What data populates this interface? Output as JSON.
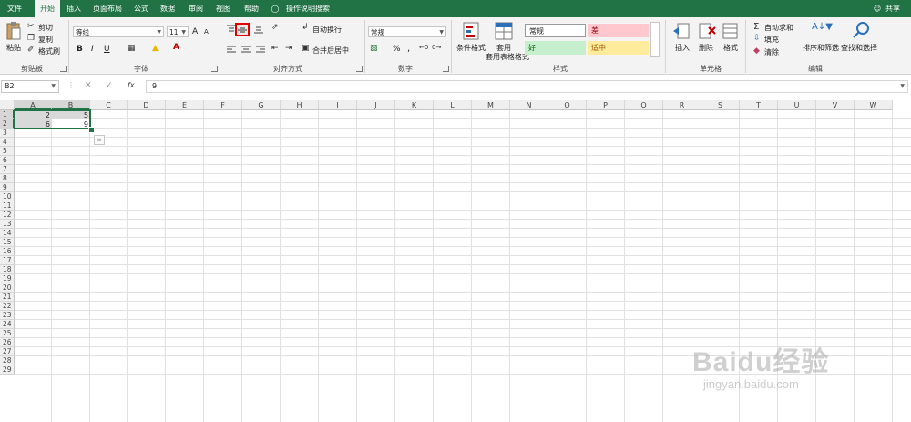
{
  "tabs": [
    "文件",
    "开始",
    "插入",
    "页面布局",
    "公式",
    "数据",
    "审阅",
    "视图",
    "帮助"
  ],
  "active_tab": "开始",
  "tell_me": "操作说明搜索",
  "share": "共享",
  "clipboard": {
    "paste": "粘贴",
    "cut": "剪切",
    "copy": "复制",
    "format_painter": "格式刷",
    "group": "剪贴板"
  },
  "font": {
    "name": "等线",
    "size": "11",
    "group": "字体",
    "bold": "B",
    "italic": "I",
    "underline": "U",
    "grow": "A",
    "shrink": "A"
  },
  "alignment": {
    "wrap": "自动换行",
    "merge": "合并后居中",
    "group": "对齐方式"
  },
  "number": {
    "format": "常规",
    "percent": "%",
    "comma": ",",
    "group": "数字"
  },
  "styles": {
    "conditional": "条件格式",
    "table_format": "套用表格格式",
    "normal": "常规",
    "bad": "差",
    "good": "好",
    "neutral": "适中",
    "group": "样式"
  },
  "cells": {
    "insert": "插入",
    "delete": "删除",
    "format": "格式",
    "group": "单元格"
  },
  "editing": {
    "autosum": "自动求和",
    "fill": "填充",
    "clear": "清除",
    "sort_filter": "排序和筛选",
    "find_select": "查找和选择",
    "group": "编辑"
  },
  "formula_bar": {
    "name_box": "B2",
    "fx": "fx",
    "value": "9"
  },
  "columns": [
    "A",
    "B",
    "C",
    "D",
    "E",
    "F",
    "G",
    "H",
    "I",
    "J",
    "K",
    "L",
    "M",
    "N",
    "O",
    "P",
    "Q",
    "R",
    "S",
    "T",
    "U",
    "V",
    "W"
  ],
  "rows": [
    "1",
    "2",
    "3",
    "4",
    "5",
    "6",
    "7",
    "8",
    "9",
    "10",
    "11",
    "12",
    "13",
    "14",
    "15",
    "16",
    "17",
    "18",
    "19",
    "20",
    "21",
    "22",
    "23",
    "24",
    "25",
    "26",
    "27",
    "28",
    "29"
  ],
  "cells_data": {
    "A1": "2",
    "B1": "5",
    "A2": "6",
    "B2": "9"
  },
  "watermark": "Baidu经验",
  "watermark_url": "jingyan.baidu.com",
  "colors": {
    "accent": "#217346",
    "selection": "#c6c6c6",
    "highlight_box": "#e00000"
  }
}
